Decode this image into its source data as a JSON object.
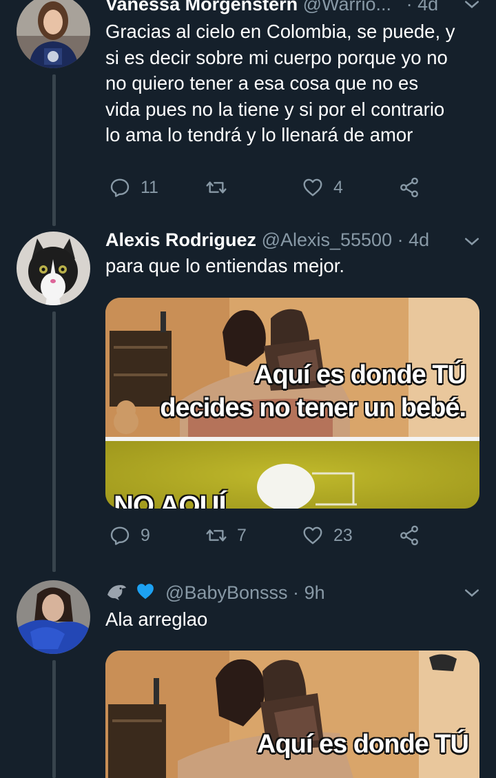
{
  "colors": {
    "background": "#15202b",
    "muted": "#8899a6",
    "heart": "#1da1f2"
  },
  "tweets": [
    {
      "name": "Vanessa Morgenstern",
      "handle": "@Warrio...",
      "sep": "·",
      "time": "4d",
      "text": [
        "Gracias al cielo en Colombia, se puede, y",
        "si es decir sobre mi cuerpo porque yo no",
        "no quiero tener a esa cosa que no es",
        "vida pues no la tiene y si por el contrario",
        "lo ama lo tendrá y lo llenará de amor"
      ],
      "replies": "11",
      "retweets": "",
      "likes": "4"
    },
    {
      "name": "Alexis Rodriguez",
      "handle": "@Alexis_55500",
      "sep": "·",
      "time": "4d",
      "text": [
        "para que lo entiendas mejor."
      ],
      "media_caption": [
        "Aquí es donde TÚ",
        "decides no tener un bebé."
      ],
      "media_bottom_text": "NO AQUÍ",
      "replies": "9",
      "retweets": "7",
      "likes": "23"
    },
    {
      "name_emoji": [
        "dolphin-icon",
        "blue-heart-icon"
      ],
      "handle": "@BabyBonsss",
      "sep": "·",
      "time": "9h",
      "text": [
        "Ala arreglao"
      ],
      "media_caption": [
        "Aquí es donde TÚ"
      ]
    }
  ]
}
